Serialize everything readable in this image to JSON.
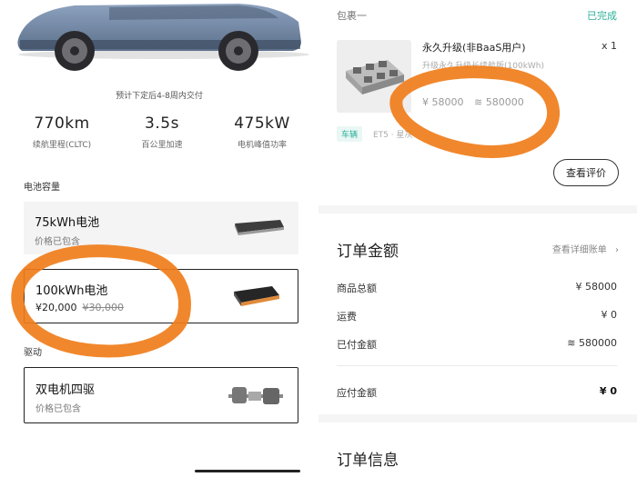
{
  "left": {
    "delivery_note": "预计下定后4-8周内交付",
    "specs": [
      {
        "value": "770km",
        "label": "续航里程(CLTC)"
      },
      {
        "value": "3.5s",
        "label": "百公里加速"
      },
      {
        "value": "475kW",
        "label": "电机峰值功率"
      }
    ],
    "battery_section": "电池容量",
    "battery_options": [
      {
        "name": "75kWh电池",
        "sub": "价格已包含"
      },
      {
        "name": "100kWh电池",
        "price_now": "¥20,000",
        "price_old": "¥30,000"
      }
    ],
    "drive_section": "驱动",
    "drive_option": {
      "name": "双电机四驱",
      "sub": "价格已包含"
    }
  },
  "right": {
    "package_label": "包裹一",
    "package_status": "已完成",
    "product": {
      "name": "永久升级(非BaaS用户)",
      "qty": "x 1",
      "desc": "升级永久升级长续航版(100kWh)",
      "price": "¥ 58000",
      "points": "580000"
    },
    "tag_vehicle": "车辆",
    "tag_spec": "ET5 · 星灰",
    "review_button": "查看评价",
    "summary": {
      "title": "订单金额",
      "view_bill": "查看详细账单",
      "rows": [
        {
          "label": "商品总额",
          "value": "¥ 58000"
        },
        {
          "label": "运费",
          "value": "¥ 0"
        },
        {
          "label": "已付金额",
          "value": "580000"
        }
      ],
      "payable": {
        "label": "应付金额",
        "value": "¥ 0"
      }
    },
    "info_title": "订单信息"
  },
  "colors": {
    "accent": "#2bb09a",
    "annotation": "#f07d1a"
  }
}
